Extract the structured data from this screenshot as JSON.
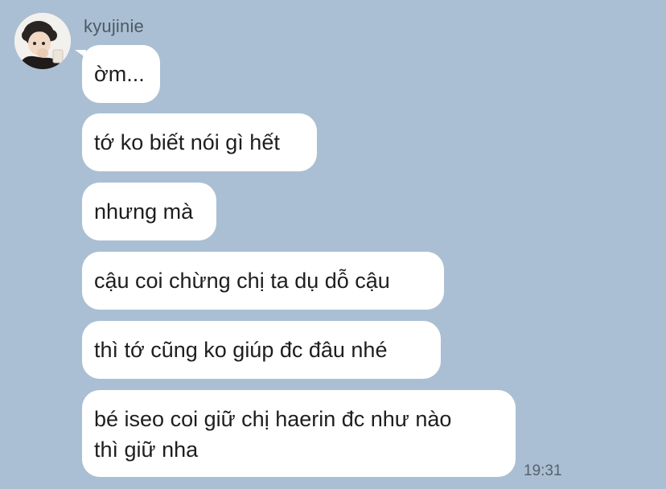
{
  "conversation": {
    "sender_name": "kyujinie",
    "avatar_icon": "user-avatar-photo",
    "messages": [
      {
        "lines": [
          "ờm..."
        ]
      },
      {
        "lines": [
          "tớ ko biết nói gì hết"
        ]
      },
      {
        "lines": [
          "nhưng mà"
        ]
      },
      {
        "lines": [
          "cậu coi chừng chị ta dụ dỗ cậu"
        ]
      },
      {
        "lines": [
          "thì tớ cũng ko giúp đc đâu nhé"
        ]
      },
      {
        "lines": [
          "bé iseo coi giữ chị haerin đc như nào",
          "thì giữ nha"
        ]
      }
    ],
    "timestamp": "19:31"
  },
  "colors": {
    "background": "#aabfd3",
    "bubble": "#ffffff",
    "text": "#1e1e1e"
  }
}
